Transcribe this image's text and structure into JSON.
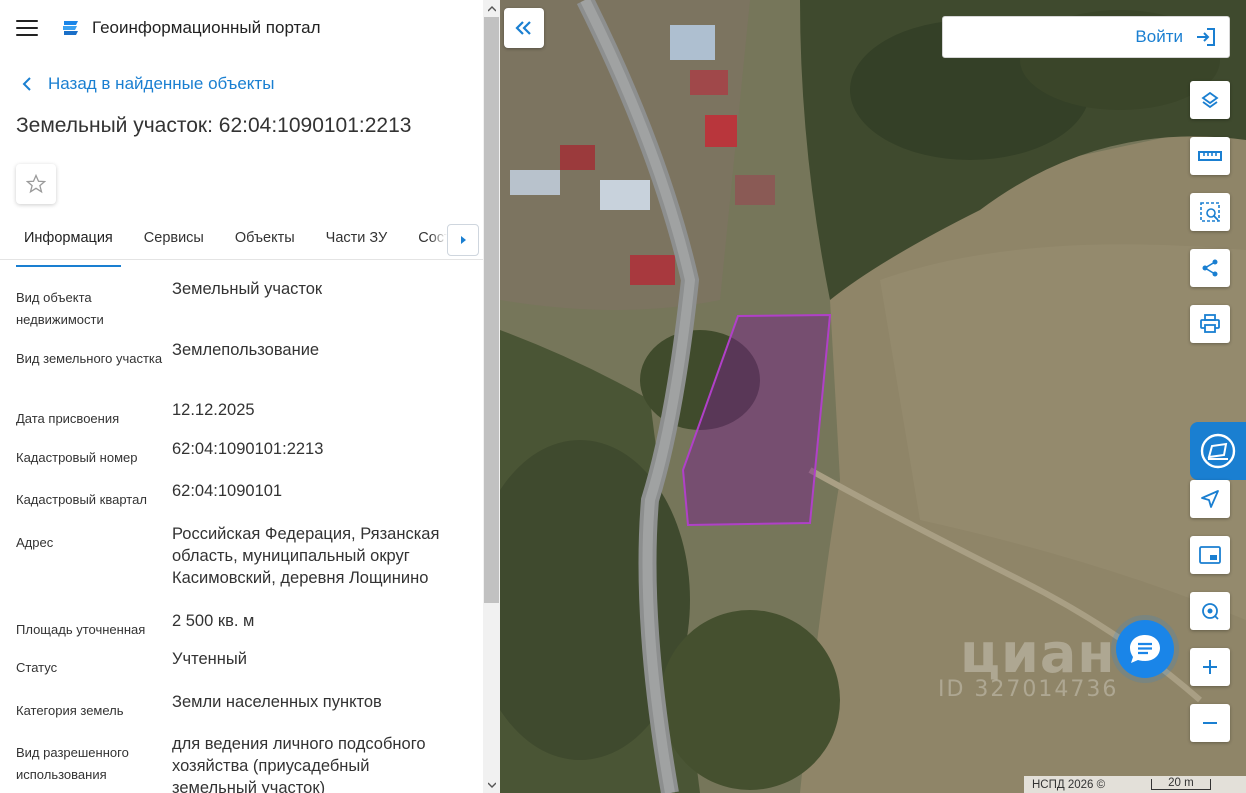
{
  "header": {
    "portal_title": "Геоинформационный портал"
  },
  "nav": {
    "back_label": "Назад в найденные объекты"
  },
  "object": {
    "title": "Земельный участок: 62:04:1090101:2213"
  },
  "tabs": [
    {
      "label": "Информация",
      "active": true
    },
    {
      "label": "Сервисы"
    },
    {
      "label": "Объекты"
    },
    {
      "label": "Части ЗУ"
    },
    {
      "label": "Состав"
    }
  ],
  "properties": [
    {
      "label": "Вид объекта недвижимости",
      "value": "Земельный участок"
    },
    {
      "label": "Вид земельного участка",
      "value": "Землепользование"
    },
    {
      "label": "Дата присвоения",
      "value": "12.12.2025"
    },
    {
      "label": "Кадастровый номер",
      "value": "62:04:1090101:2213"
    },
    {
      "label": "Кадастровый квартал",
      "value": "62:04:1090101"
    },
    {
      "label": "Адрес",
      "value": "Российская Федерация, Рязанская область, муниципальный округ Касимовский, деревня Лощинино"
    },
    {
      "label": "Площадь уточненная",
      "value": "2 500 кв. м"
    },
    {
      "label": "Статус",
      "value": "Учтенный"
    },
    {
      "label": "Категория земель",
      "value": "Земли населенных пунктов"
    },
    {
      "label": "Вид разрешенного использования",
      "value": "для ведения личного подсобного хозяйства (приусадебный земельный участок)"
    }
  ],
  "map": {
    "login_label": "Войти",
    "watermark_brand": "циан",
    "watermark_id": "ID 327014736",
    "attribution": "НСПД 2026 ©",
    "scale_label": "20 m",
    "tools": [
      "layers-icon",
      "ruler-icon",
      "select-area-icon",
      "share-icon",
      "print-icon",
      "navigate-icon",
      "picture-in-picture-icon",
      "locate-icon",
      "zoom-in-icon",
      "zoom-out-icon"
    ]
  },
  "colors": {
    "accent": "#1a7fd1",
    "parcel_outline": "#b040c8"
  }
}
